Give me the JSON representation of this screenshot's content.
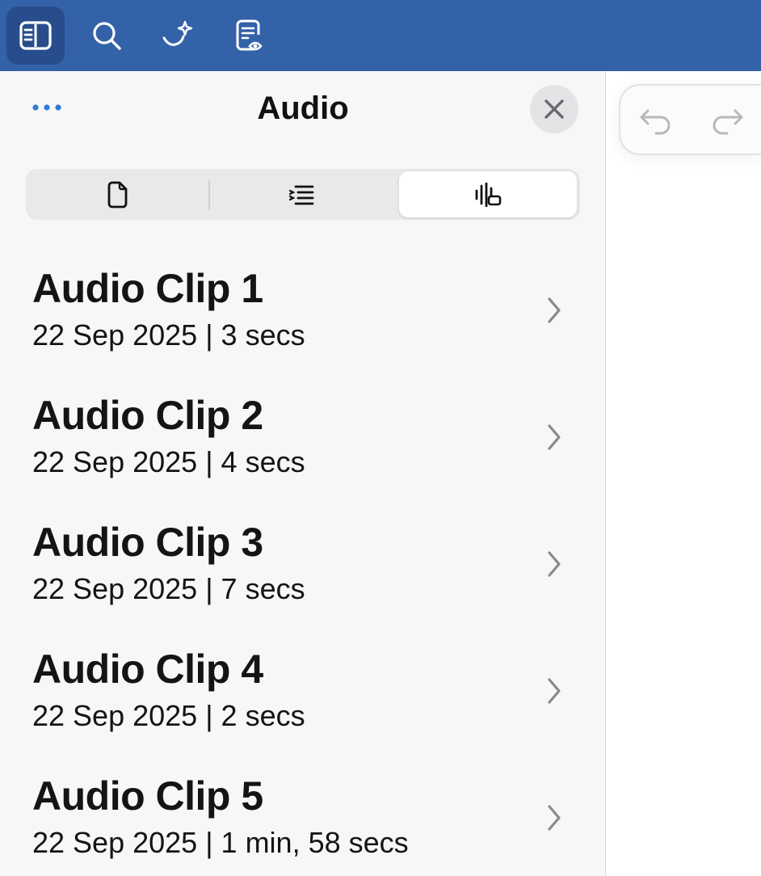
{
  "toolbar": {
    "buttons": [
      {
        "icon": "sidebar-icon",
        "active": true
      },
      {
        "icon": "search-icon",
        "active": false
      },
      {
        "icon": "sparkle-ink-icon",
        "active": false
      },
      {
        "icon": "document-preview-icon",
        "active": false
      }
    ]
  },
  "panel": {
    "title": "Audio",
    "more_icon": "more-dots-icon",
    "close_icon": "close-icon",
    "segments": [
      {
        "icon": "page-icon",
        "selected": false
      },
      {
        "icon": "outline-list-icon",
        "selected": false
      },
      {
        "icon": "audio-waveform-icon",
        "selected": true
      }
    ],
    "clips": [
      {
        "title": "Audio Clip 1",
        "meta": "22 Sep 2025 | 3 secs"
      },
      {
        "title": "Audio Clip 2",
        "meta": "22 Sep 2025 | 4 secs"
      },
      {
        "title": "Audio Clip 3",
        "meta": "22 Sep 2025 | 7 secs"
      },
      {
        "title": "Audio Clip 4",
        "meta": "22 Sep 2025 | 2 secs"
      },
      {
        "title": "Audio Clip 5",
        "meta": "22 Sep 2025 | 1 min, 58 secs"
      }
    ]
  },
  "history": {
    "undo_icon": "undo-icon",
    "redo_icon": "redo-icon"
  },
  "colors": {
    "toolbar_bg": "#3462a8",
    "accent": "#2f78d6",
    "panel_bg": "#f7f7f7"
  }
}
